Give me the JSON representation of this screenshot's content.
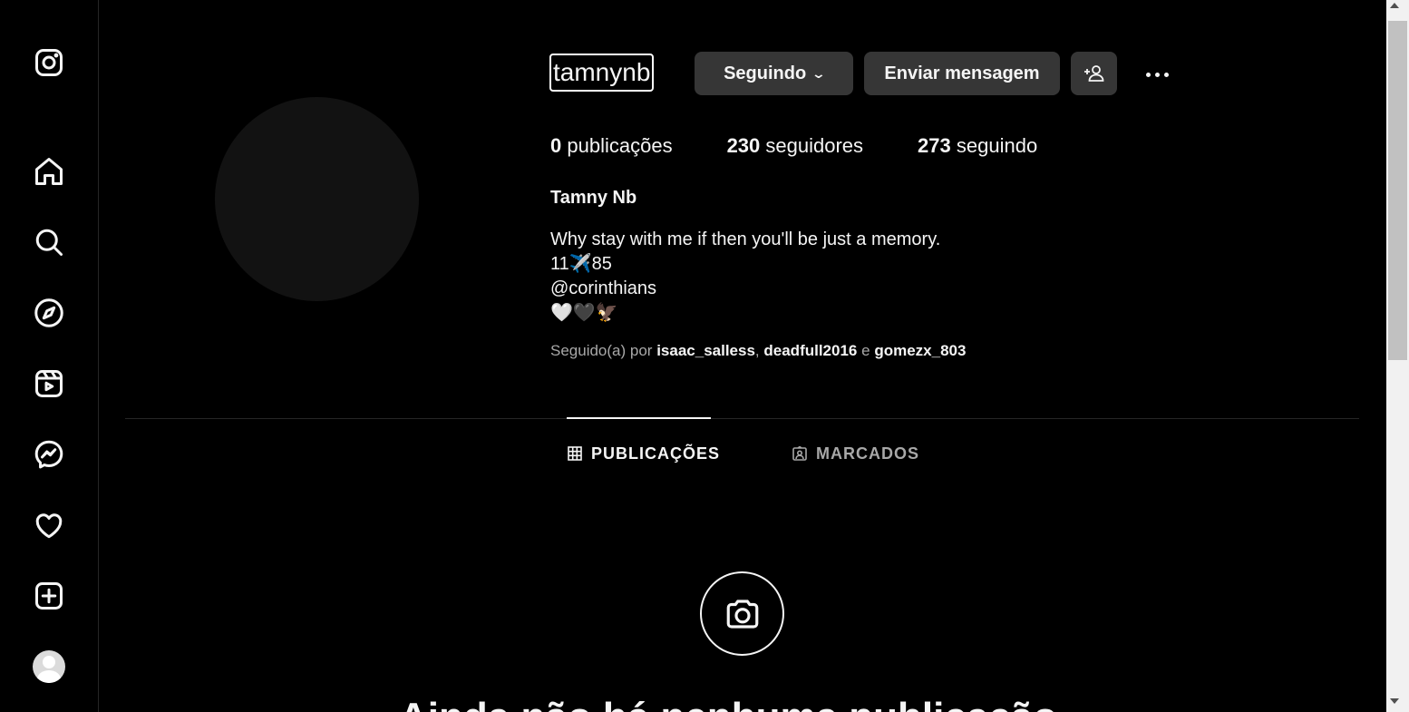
{
  "sidebar": {
    "items": [
      {
        "name": "instagram-logo-icon"
      },
      {
        "name": "home-icon"
      },
      {
        "name": "search-icon"
      },
      {
        "name": "explore-icon"
      },
      {
        "name": "reels-icon"
      },
      {
        "name": "messenger-icon"
      },
      {
        "name": "notifications-heart-icon"
      },
      {
        "name": "create-icon"
      },
      {
        "name": "profile-avatar"
      }
    ]
  },
  "profile": {
    "username": "tamnynb",
    "following_button_label": "Seguindo",
    "message_button_label": "Enviar mensagem",
    "stats": {
      "posts_count": "0",
      "posts_label": "publicações",
      "followers_count": "230",
      "followers_label": "seguidores",
      "following_count": "273",
      "following_label": "seguindo"
    },
    "full_name": "Tamny Nb",
    "bio": [
      "Why stay with me if then you'll be just a memory.",
      "11✈️85",
      "@corinthians",
      "🤍🖤🦅"
    ],
    "followed_by": {
      "prefix": "Seguido(a) por",
      "user1": "isaac_salless",
      "separator": ",",
      "user2": "deadfull2016",
      "conjunction": "e",
      "user3": "gomezx_803"
    }
  },
  "tabs": {
    "posts_label": "PUBLICAÇÕES",
    "tagged_label": "MARCADOS",
    "active": "PUBLICAÇÕES"
  },
  "empty_state": {
    "title": "Ainda não há nenhuma publicação"
  },
  "colors": {
    "background": "#000000",
    "button": "#363636",
    "text": "#f5f5f5",
    "muted_text": "#a8a8a8",
    "divider": "#262626"
  }
}
